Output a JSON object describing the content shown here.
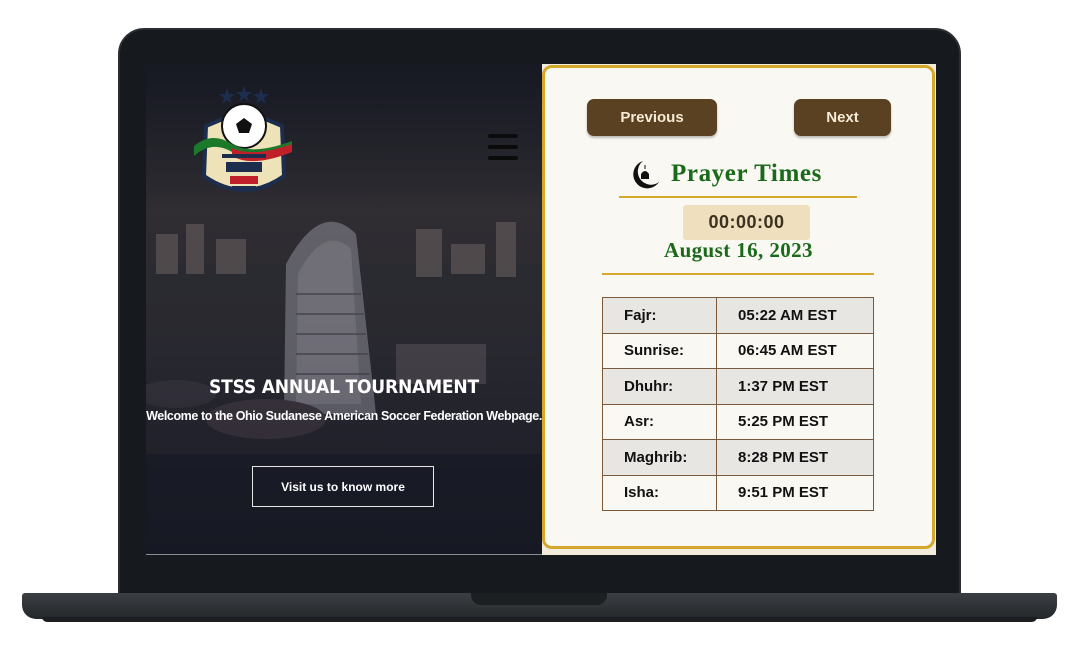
{
  "hero": {
    "title": "STSS ANNUAL TOURNAMENT",
    "subtitle": "Welcome to the Ohio Sudanese American Soccer Federation Webpage.",
    "cta_label": "Visit us to know more",
    "logo_icon": "soccer-federation-logo",
    "menu_icon": "hamburger-menu-icon"
  },
  "prayer": {
    "prev_label": "Previous",
    "next_label": "Next",
    "title": "Prayer Times",
    "title_icon": "crescent-mosque-icon",
    "clock": "00:00:00",
    "date": "August 16, 2023",
    "times": [
      {
        "name": "Fajr:",
        "time": "05:22 AM EST"
      },
      {
        "name": "Sunrise:",
        "time": "06:45 AM EST"
      },
      {
        "name": "Dhuhr:",
        "time": "1:37 PM EST"
      },
      {
        "name": "Asr:",
        "time": "5:25 PM EST"
      },
      {
        "name": "Maghrib:",
        "time": "8:28 PM EST"
      },
      {
        "name": "Isha:",
        "time": "9:51 PM EST"
      }
    ]
  },
  "colors": {
    "accent_gold": "#d4a82a",
    "button_brown": "#5a4122",
    "title_green": "#1a6a1a",
    "card_bg": "#faf8f2"
  }
}
